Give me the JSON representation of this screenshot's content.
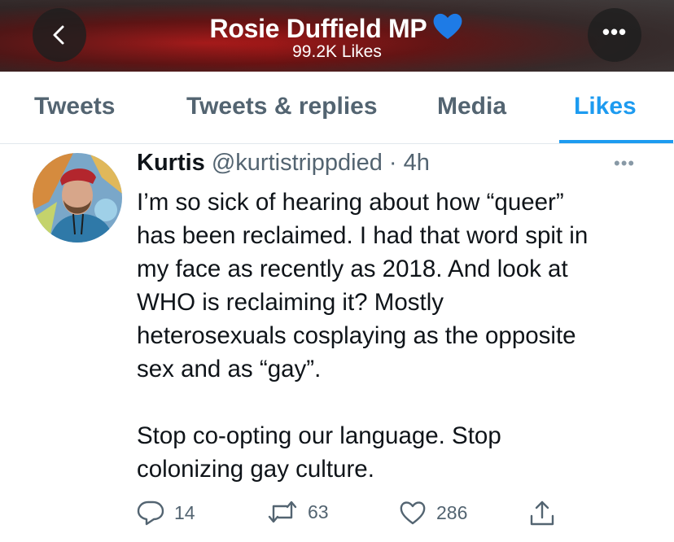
{
  "header": {
    "title": "Rosie Duffield MP",
    "likes_count": "99.2K Likes",
    "title_emoji": "blue-heart",
    "back_icon": "chevron-left-icon",
    "more_icon": "more-horizontal-icon",
    "more_glyph": "•••"
  },
  "tabs": [
    {
      "label": "Tweets",
      "active": false
    },
    {
      "label": "Tweets & replies",
      "active": false
    },
    {
      "label": "Media",
      "active": false
    },
    {
      "label": "Likes",
      "active": true
    }
  ],
  "tweet": {
    "display_name": "Kurtis",
    "handle": "@kurtistrippdied",
    "separator": "·",
    "time": "4h",
    "more_glyph": "•••",
    "text": "I’m so sick of hearing about how “queer”\nhas been reclaimed. I had that word spit in\nmy face as recently as 2018. And look at\nWHO is reclaiming it? Mostly\nheterosexuals cosplaying as the opposite\nsex and as “gay”.\n\nStop co-opting our language. Stop\ncolonizing gay culture.",
    "actions": {
      "reply_count": "14",
      "retweet_count": "63",
      "like_count": "286"
    }
  },
  "colors": {
    "accent": "#1d9bf0",
    "muted": "#536471",
    "text": "#0f1419"
  }
}
